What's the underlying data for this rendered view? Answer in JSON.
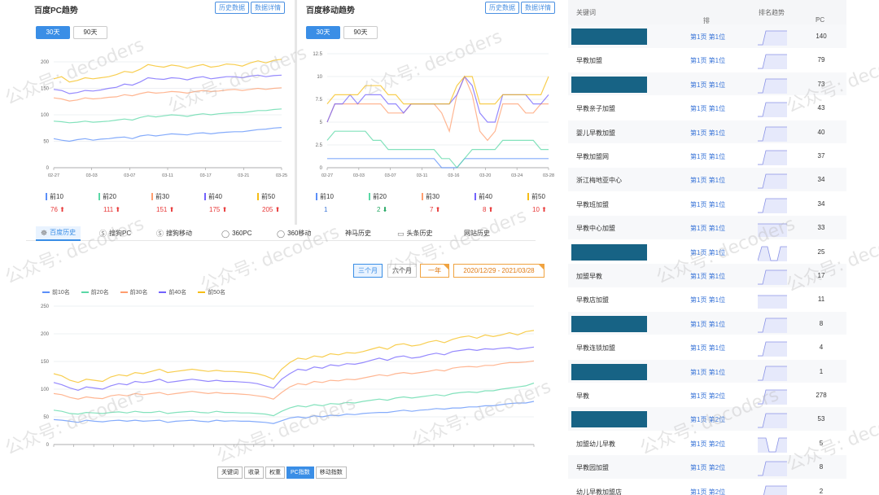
{
  "pc_panel": {
    "title": "百度PC趋势",
    "btn_history": "历史数据",
    "btn_detail": "数据详情",
    "period_30": "30天",
    "period_90": "90天",
    "y_ticks": [
      "0",
      "50",
      "100",
      "150",
      "200"
    ],
    "x_ticks": [
      "02-27",
      "03-03",
      "03-07",
      "03-11",
      "03-17",
      "03-21",
      "03-25"
    ],
    "stats": [
      {
        "label": "前10",
        "value": "76",
        "dir": "up",
        "color": "#5b8ff9"
      },
      {
        "label": "前20",
        "value": "111",
        "dir": "up",
        "color": "#5ad8a6"
      },
      {
        "label": "前30",
        "value": "151",
        "dir": "up",
        "color": "#ff9d6e"
      },
      {
        "label": "前40",
        "value": "175",
        "dir": "up",
        "color": "#7262fd"
      },
      {
        "label": "前50",
        "value": "205",
        "dir": "up",
        "color": "#f6bd16"
      }
    ]
  },
  "mobile_panel": {
    "title": "百度移动趋势",
    "btn_history": "历史数据",
    "btn_detail": "数据详情",
    "period_30": "30天",
    "period_90": "90天",
    "y_ticks": [
      "0",
      "2.5",
      "5",
      "7.5",
      "10",
      "12.5"
    ],
    "x_ticks": [
      "02-27",
      "03-03",
      "03-07",
      "03-11",
      "03-16",
      "03-20",
      "03-24",
      "03-28"
    ],
    "stats": [
      {
        "label": "前10",
        "value": "1",
        "dir": "none",
        "color": "#5b8ff9"
      },
      {
        "label": "前20",
        "value": "2",
        "dir": "down",
        "color": "#5ad8a6"
      },
      {
        "label": "前30",
        "value": "7",
        "dir": "up",
        "color": "#ff9d6e"
      },
      {
        "label": "前40",
        "value": "8",
        "dir": "up",
        "color": "#7262fd"
      },
      {
        "label": "前50",
        "value": "10",
        "dir": "up",
        "color": "#f6bd16"
      }
    ]
  },
  "tabs": [
    {
      "label": "百度历史",
      "icon": "☸",
      "active": true
    },
    {
      "label": "搜狗PC",
      "icon": "Ⓢ",
      "active": false
    },
    {
      "label": "搜狗移动",
      "icon": "Ⓢ",
      "active": false
    },
    {
      "label": "360PC",
      "icon": "◯",
      "active": false
    },
    {
      "label": "360移动",
      "icon": "◯",
      "active": false
    },
    {
      "label": "神马历史",
      "icon": "",
      "active": false
    },
    {
      "label": "头条历史",
      "icon": "▭",
      "active": false
    },
    {
      "label": "网站历史",
      "icon": "",
      "active": false
    }
  ],
  "range": {
    "three_months": "三个月",
    "six_months": "六个月",
    "one_year": "一年",
    "date_range": "2020/12/29 - 2021/03/28"
  },
  "history_chart": {
    "legend": [
      "前10名",
      "前20名",
      "前30名",
      "前40名",
      "前50名"
    ],
    "y_ticks": [
      "0",
      "50",
      "100",
      "150",
      "200"
    ]
  },
  "bottom_buttons": [
    {
      "label": "关键词",
      "active": false
    },
    {
      "label": "收录",
      "active": false
    },
    {
      "label": "权重",
      "active": false
    },
    {
      "label": "PC指数",
      "active": true
    },
    {
      "label": "移动指数",
      "active": false
    }
  ],
  "table": {
    "headers": {
      "keyword": "关键词",
      "rank": "排名",
      "trend": "排名趋势",
      "index": "PC指数"
    },
    "rows": [
      {
        "keyword": "",
        "masked": true,
        "rank": "第1页 第1位",
        "index": "140"
      },
      {
        "keyword": "早教加盟",
        "masked": false,
        "rank": "第1页 第1位",
        "index": "79"
      },
      {
        "keyword": "",
        "masked": true,
        "rank": "第1页 第1位",
        "index": "73"
      },
      {
        "keyword": "早教亲子加盟",
        "masked": false,
        "rank": "第1页 第1位",
        "index": "43"
      },
      {
        "keyword": "婴儿早教加盟",
        "masked": false,
        "rank": "第1页 第1位",
        "index": "40"
      },
      {
        "keyword": "早教加盟网",
        "masked": false,
        "rank": "第1页 第1位",
        "index": "37"
      },
      {
        "keyword": "浙江梅地亚中心",
        "masked": false,
        "rank": "第1页 第1位",
        "index": "34"
      },
      {
        "keyword": "早教班加盟",
        "masked": false,
        "rank": "第1页 第1位",
        "index": "34"
      },
      {
        "keyword": "早教中心加盟",
        "masked": false,
        "rank": "第1页 第1位",
        "index": "33"
      },
      {
        "keyword": "",
        "masked": true,
        "rank": "第1页 第1位",
        "index": "25"
      },
      {
        "keyword": "加盟早教",
        "masked": false,
        "rank": "第1页 第1位",
        "index": "17"
      },
      {
        "keyword": "早教店加盟",
        "masked": false,
        "rank": "第1页 第1位",
        "index": "11"
      },
      {
        "keyword": "",
        "masked": true,
        "rank": "第1页 第1位",
        "index": "8"
      },
      {
        "keyword": "早教连锁加盟",
        "masked": false,
        "rank": "第1页 第1位",
        "index": "4"
      },
      {
        "keyword": "",
        "masked": true,
        "rank": "第1页 第1位",
        "index": "1"
      },
      {
        "keyword": "早教",
        "masked": false,
        "rank": "第1页 第2位",
        "index": "278"
      },
      {
        "keyword": "",
        "masked": true,
        "rank": "第1页 第2位",
        "index": "53"
      },
      {
        "keyword": "加盟幼儿早教",
        "masked": false,
        "rank": "第1页 第2位",
        "index": "5"
      },
      {
        "keyword": "早教园加盟",
        "masked": false,
        "rank": "第1页 第2位",
        "index": "8"
      },
      {
        "keyword": "幼儿早教加盟店",
        "masked": false,
        "rank": "第1页 第2位",
        "index": "2"
      }
    ]
  },
  "watermark": "公众号: decoders",
  "colors": {
    "accent": "#3a8ee6",
    "series": [
      "#5b8ff9",
      "#5ad8a6",
      "#ff9d6e",
      "#7262fd",
      "#f6bd16"
    ],
    "mask": "#176385"
  },
  "chart_data": [
    {
      "type": "line",
      "ylim": [
        0,
        200
      ],
      "categories": [
        "02-27",
        "02-28",
        "03-01",
        "03-02",
        "03-03",
        "03-04",
        "03-05",
        "03-06",
        "03-07",
        "03-08",
        "03-09",
        "03-10",
        "03-11",
        "03-12",
        "03-13",
        "03-14",
        "03-15",
        "03-16",
        "03-17",
        "03-18",
        "03-19",
        "03-20",
        "03-21",
        "03-22",
        "03-23",
        "03-24",
        "03-25",
        "03-26",
        "03-27",
        "03-28"
      ],
      "series": [
        {
          "name": "前10",
          "values": [
            55,
            52,
            50,
            53,
            55,
            52,
            54,
            55,
            57,
            58,
            55,
            60,
            62,
            60,
            62,
            64,
            63,
            62,
            65,
            66,
            64,
            66,
            67,
            68,
            68,
            70,
            72,
            73,
            75,
            76
          ]
        },
        {
          "name": "前20",
          "values": [
            88,
            87,
            85,
            86,
            88,
            86,
            87,
            88,
            90,
            92,
            90,
            95,
            98,
            96,
            98,
            100,
            99,
            97,
            100,
            102,
            100,
            102,
            103,
            104,
            104,
            106,
            108,
            108,
            110,
            111
          ]
        },
        {
          "name": "前30",
          "values": [
            132,
            130,
            126,
            128,
            132,
            130,
            131,
            133,
            134,
            138,
            136,
            140,
            143,
            141,
            142,
            144,
            143,
            141,
            144,
            146,
            144,
            145,
            147,
            148,
            146,
            148,
            150,
            148,
            150,
            151
          ]
        },
        {
          "name": "前40",
          "values": [
            148,
            146,
            140,
            142,
            146,
            145,
            147,
            150,
            152,
            158,
            156,
            162,
            170,
            168,
            167,
            170,
            169,
            166,
            170,
            172,
            168,
            170,
            172,
            172,
            170,
            173,
            175,
            172,
            174,
            175
          ]
        },
        {
          "name": "前50",
          "values": [
            168,
            172,
            162,
            165,
            170,
            168,
            170,
            172,
            176,
            182,
            180,
            186,
            195,
            192,
            190,
            194,
            192,
            188,
            192,
            195,
            190,
            192,
            196,
            195,
            192,
            198,
            202,
            198,
            203,
            205
          ]
        }
      ]
    },
    {
      "type": "line",
      "ylim": [
        0,
        12.5
      ],
      "categories": [
        "02-27",
        "02-28",
        "03-01",
        "03-02",
        "03-03",
        "03-04",
        "03-05",
        "03-06",
        "03-07",
        "03-08",
        "03-09",
        "03-10",
        "03-11",
        "03-12",
        "03-13",
        "03-14",
        "03-15",
        "03-16",
        "03-17",
        "03-18",
        "03-19",
        "03-20",
        "03-21",
        "03-22",
        "03-23",
        "03-24",
        "03-25",
        "03-26",
        "03-27",
        "03-28"
      ],
      "series": [
        {
          "name": "前10",
          "values": [
            1,
            1,
            1,
            1,
            1,
            1,
            1,
            1,
            1,
            1,
            1,
            1,
            1,
            1,
            1,
            0,
            0,
            0,
            1,
            1,
            1,
            1,
            1,
            1,
            1,
            1,
            1,
            1,
            1,
            1
          ]
        },
        {
          "name": "前20",
          "values": [
            3,
            4,
            4,
            4,
            4,
            4,
            3,
            3,
            2,
            2,
            2,
            2,
            2,
            2,
            2,
            1,
            1,
            0,
            1,
            2,
            2,
            2,
            2,
            3,
            3,
            3,
            3,
            3,
            2,
            2
          ]
        },
        {
          "name": "前30",
          "values": [
            5,
            7,
            7,
            7,
            7,
            7,
            7,
            7,
            6,
            6,
            6,
            7,
            7,
            7,
            7,
            6,
            4,
            8,
            10,
            8,
            4,
            3,
            4,
            7,
            7,
            7,
            6,
            6,
            7,
            7
          ]
        },
        {
          "name": "前40",
          "values": [
            5,
            7,
            7,
            8,
            7,
            8,
            8,
            8,
            7,
            7,
            6,
            7,
            7,
            7,
            7,
            7,
            7,
            8,
            10,
            9,
            6,
            5,
            5,
            8,
            8,
            8,
            8,
            7,
            7,
            8
          ]
        },
        {
          "name": "前50",
          "values": [
            7,
            8,
            8,
            8,
            8,
            9,
            9,
            9,
            8,
            8,
            7,
            7,
            7,
            7,
            7,
            7,
            7,
            9,
            10,
            10,
            7,
            7,
            7,
            8,
            8,
            8,
            8,
            8,
            8,
            10
          ]
        }
      ]
    },
    {
      "type": "line",
      "ylim": [
        0,
        250
      ],
      "series": [
        {
          "name": "前10名",
          "values": [
            45,
            44,
            42,
            40,
            44,
            42,
            41,
            43,
            44,
            42,
            44,
            42,
            43,
            44,
            40,
            42,
            43,
            44,
            42,
            41,
            44,
            42,
            43,
            42,
            42,
            41,
            40,
            38,
            43,
            48,
            50,
            48,
            52,
            50,
            53,
            52,
            55,
            54,
            56,
            57,
            58,
            58,
            60,
            62,
            60,
            62,
            63,
            65,
            64,
            66,
            66,
            68,
            68,
            70,
            70,
            72,
            74,
            75,
            75,
            78
          ]
        },
        {
          "name": "前20名",
          "values": [
            62,
            60,
            56,
            55,
            58,
            57,
            56,
            58,
            59,
            57,
            60,
            58,
            58,
            60,
            56,
            58,
            59,
            60,
            58,
            57,
            60,
            58,
            58,
            57,
            57,
            56,
            55,
            52,
            60,
            66,
            70,
            68,
            72,
            70,
            74,
            73,
            76,
            75,
            78,
            80,
            82,
            80,
            84,
            86,
            84,
            86,
            88,
            90,
            88,
            92,
            94,
            95,
            94,
            97,
            97,
            100,
            102,
            104,
            106,
            111
          ]
        },
        {
          "name": "前30名",
          "values": [
            92,
            90,
            85,
            82,
            86,
            84,
            83,
            88,
            90,
            88,
            92,
            90,
            92,
            94,
            90,
            92,
            94,
            96,
            94,
            92,
            94,
            92,
            92,
            91,
            90,
            88,
            86,
            82,
            94,
            104,
            110,
            108,
            114,
            112,
            116,
            115,
            118,
            117,
            120,
            123,
            126,
            124,
            128,
            130,
            128,
            130,
            132,
            135,
            133,
            138,
            140,
            141,
            140,
            143,
            143,
            146,
            148,
            148,
            149,
            151
          ]
        },
        {
          "name": "前40名",
          "values": [
            112,
            108,
            102,
            98,
            104,
            102,
            100,
            106,
            110,
            108,
            114,
            112,
            114,
            118,
            112,
            114,
            116,
            118,
            116,
            114,
            116,
            114,
            114,
            113,
            112,
            110,
            106,
            102,
            118,
            128,
            136,
            134,
            140,
            138,
            144,
            142,
            146,
            145,
            148,
            152,
            156,
            152,
            158,
            160,
            156,
            158,
            162,
            165,
            162,
            168,
            170,
            172,
            170,
            173,
            172,
            174,
            175,
            172,
            174,
            176
          ]
        },
        {
          "name": "前50名",
          "values": [
            128,
            124,
            116,
            112,
            118,
            116,
            114,
            122,
            126,
            124,
            130,
            128,
            132,
            136,
            130,
            132,
            134,
            136,
            134,
            132,
            134,
            132,
            132,
            131,
            130,
            128,
            124,
            118,
            136,
            148,
            156,
            154,
            160,
            158,
            164,
            162,
            166,
            165,
            168,
            172,
            176,
            172,
            180,
            182,
            178,
            180,
            185,
            188,
            184,
            190,
            194,
            196,
            192,
            198,
            195,
            198,
            202,
            198,
            204,
            206
          ]
        }
      ]
    }
  ]
}
